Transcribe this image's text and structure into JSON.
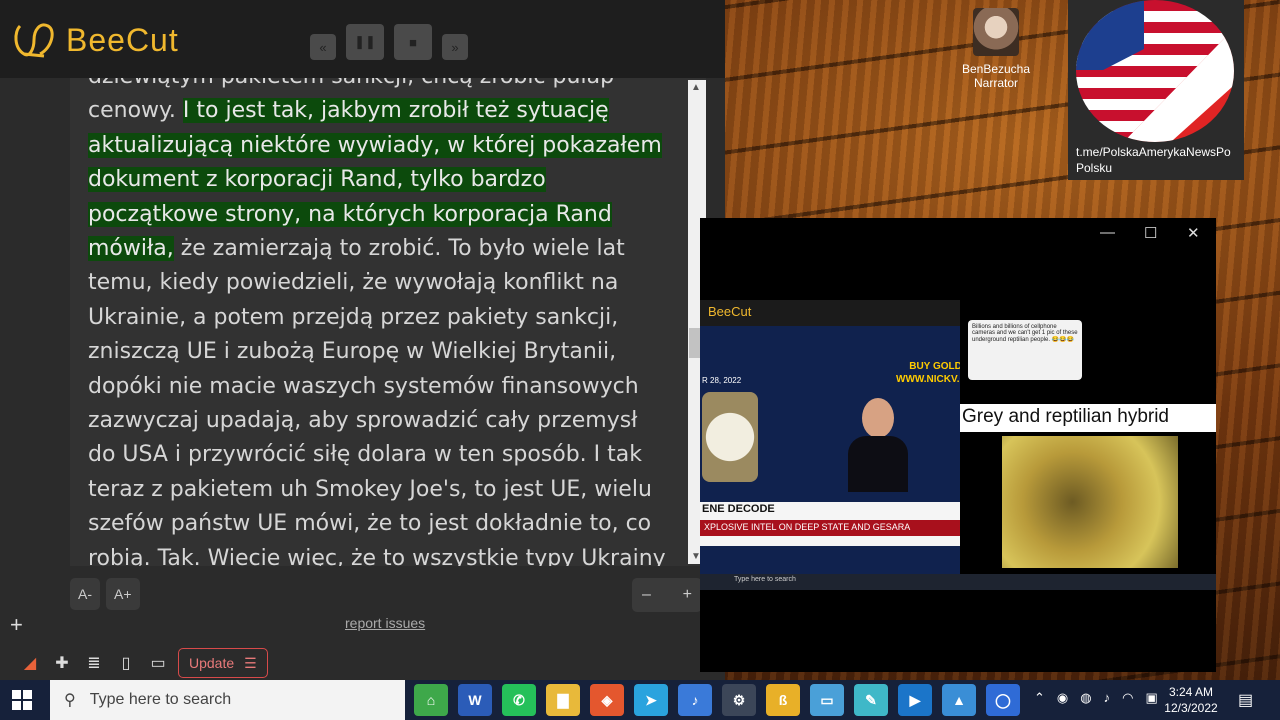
{
  "app": {
    "name": "BeeCut",
    "transcript_lines": [
      {
        "text": "dziewiątym pakietem sankcji, chcą zrobić pułap",
        "hl": false
      },
      {
        "pre": "cenowy. ",
        "text": "I to jest tak, jakbym zrobił też sytuację",
        "hl": true
      },
      {
        "text": "aktualizującą niektóre wywiady, w której pokazałem",
        "hl": true
      },
      {
        "text": "dokument z korporacji Rand, tylko bardzo",
        "hl": true
      },
      {
        "text": "początkowe strony, na których korporacja Rand",
        "hl": true
      },
      {
        "text": "mówiła,",
        "post": " że zamierzają to zrobić. To było wiele lat",
        "hl": true
      },
      {
        "text": "temu, kiedy powiedzieli, że wywołają konflikt na",
        "hl": false
      },
      {
        "text": "Ukrainie, a potem przejdą przez pakiety sankcji,",
        "hl": false
      },
      {
        "text": "zniszczą UE i zubożą Europę w Wielkiej Brytanii,",
        "hl": false
      },
      {
        "text": "dopóki nie macie waszych systemów finansowych",
        "hl": false
      },
      {
        "text": "zazwyczaj upadają, aby sprowadzić cały przemysł",
        "hl": false
      },
      {
        "text": "do USA i przywrócić siłę dolara w ten sposób. I tak",
        "hl": false
      },
      {
        "text": "teraz z pakietem uh Smokey Joe's, to jest UE, wielu",
        "hl": false
      },
      {
        "text": "szefów państw UE mówi, że to jest dokładnie to, co",
        "hl": false
      },
      {
        "text": "robią. Tak. Wiecie więc, że to wszystkie typy Ukrainy",
        "hl": false
      }
    ],
    "font_smaller": "A-",
    "font_larger": "A+",
    "zoom_out": "–",
    "zoom_in": "+",
    "report_link": "report issues",
    "update_label": "Update",
    "add_label": "+"
  },
  "narrator": {
    "name": "BenBezucha",
    "role": "Narrator"
  },
  "flag_card": {
    "link_line1": "t.me/PolskaAmerykaNewsPo",
    "link_line2": "Polsku"
  },
  "video": {
    "bee_label": "BeeCut",
    "gold_ad_line1": "BUY GOLD",
    "gold_ad_line2": "WWW.NICKV.GO",
    "date_label": "R 28, 2022",
    "strip_title": "ENE DECODE",
    "strip_subtitle": "XPLOSIVE INTEL ON DEEP STATE AND GESARA",
    "tweet": "Billions and billions of cellphone cameras and we can't get 1 pic of these underground reptilian people. 😂😂😂",
    "right_title": "Grey and reptilian hybrid",
    "mini_search": "Type here to search"
  },
  "taskbar": {
    "search_placeholder": "Type here to search",
    "time": "3:24 AM",
    "date": "12/3/2022",
    "apps": [
      {
        "name": "android-app-icon",
        "label": "⌂",
        "color": "#3ea84a"
      },
      {
        "name": "word-icon",
        "label": "W",
        "color": "#2b5cb8"
      },
      {
        "name": "whatsapp-icon",
        "label": "✆",
        "color": "#25c05a"
      },
      {
        "name": "file-explorer-icon",
        "label": "▇",
        "color": "#e8b93a"
      },
      {
        "name": "brave-icon",
        "label": "◈",
        "color": "#e4572e"
      },
      {
        "name": "telegram-icon",
        "label": "➤",
        "color": "#2aa3de"
      },
      {
        "name": "media-player-icon",
        "label": "♪",
        "color": "#3a7ad9"
      },
      {
        "name": "settings-icon",
        "label": "⚙",
        "color": "#3c4658"
      },
      {
        "name": "beecut-taskbar-icon",
        "label": "ß",
        "color": "#e8b028"
      },
      {
        "name": "photos-icon",
        "label": "▭",
        "color": "#4aa0d8"
      },
      {
        "name": "notes-icon",
        "label": "✎",
        "color": "#3fb8c8"
      },
      {
        "name": "video-editor-icon",
        "label": "▶",
        "color": "#1b75c9"
      },
      {
        "name": "image-viewer-icon",
        "label": "▲",
        "color": "#3a8ed6"
      },
      {
        "name": "cortana-icon",
        "label": "◯",
        "color": "#2f6bd6"
      }
    ]
  }
}
